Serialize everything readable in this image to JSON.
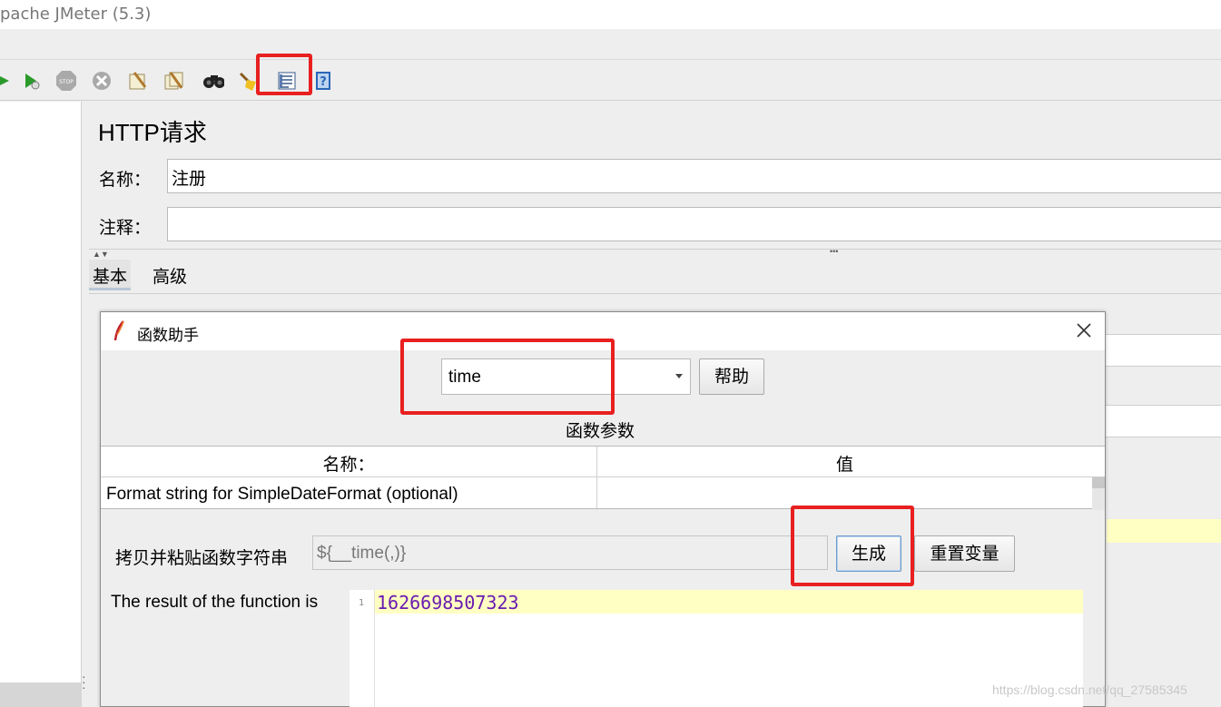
{
  "app": {
    "title": "pache JMeter (5.3)"
  },
  "toolbar": {
    "icons": [
      "start-icon",
      "start-no-pauses-icon",
      "stop-icon",
      "shutdown-icon",
      "clear-icon",
      "clear-all-icon",
      "search-icon",
      "reset-search-icon",
      "function-helper-icon",
      "help-icon"
    ]
  },
  "editor": {
    "title": "HTTP请求",
    "name_label": "名称：",
    "name_value": "注册",
    "comment_label": "注释：",
    "comment_value": "",
    "tabs": [
      {
        "label": "基本"
      },
      {
        "label": "高级"
      }
    ]
  },
  "dialog": {
    "title": "函数助手",
    "function_select": "time",
    "help_button": "帮助",
    "params_section": "函数参数",
    "table": {
      "col_name": "名称：",
      "col_value": "值",
      "rows": [
        {
          "name": "Format string for SimpleDateFormat (optional)",
          "value": ""
        }
      ]
    },
    "copy_label": "拷贝并粘贴函数字符串",
    "function_string": "${__time(,)}",
    "generate_button": "生成",
    "reset_button": "重置变量",
    "result_label": "The result of the function is",
    "result_line_number": "1",
    "result_value": "1626698507323"
  },
  "watermark": "https://blog.csdn.net/qq_27585345",
  "colors": {
    "highlight": "#e82020",
    "result_text": "#6a1bb0",
    "result_bg": "#ffffc4"
  }
}
